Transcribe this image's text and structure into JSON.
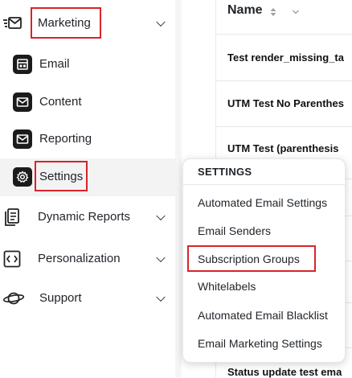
{
  "sidebar": {
    "marketing": {
      "label": "Marketing",
      "icon": "email-marketing-icon"
    },
    "sub_items": [
      {
        "label": "Email",
        "icon": "email-layout-icon"
      },
      {
        "label": "Content",
        "icon": "envelope-icon"
      },
      {
        "label": "Reporting",
        "icon": "envelope-icon"
      },
      {
        "label": "Settings",
        "icon": "gear-icon"
      }
    ],
    "items": [
      {
        "label": "Dynamic Reports",
        "icon": "document-icon"
      },
      {
        "label": "Personalization",
        "icon": "code-icon"
      },
      {
        "label": "Support",
        "icon": "planet-icon"
      }
    ]
  },
  "table": {
    "header": "Name",
    "rows": [
      "Test render_missing_ta",
      "UTM Test No Parenthes",
      "UTM Test (parenthesis",
      "Status update test ema"
    ]
  },
  "settings_menu": {
    "title": "SETTINGS",
    "items": [
      "Automated Email Settings",
      "Email Senders",
      "Subscription Groups",
      "Whitelabels",
      "Automated Email Blacklist",
      "Email Marketing Settings"
    ]
  },
  "colors": {
    "highlight": "#d9232a",
    "icon_bg": "#1b1b1b"
  }
}
